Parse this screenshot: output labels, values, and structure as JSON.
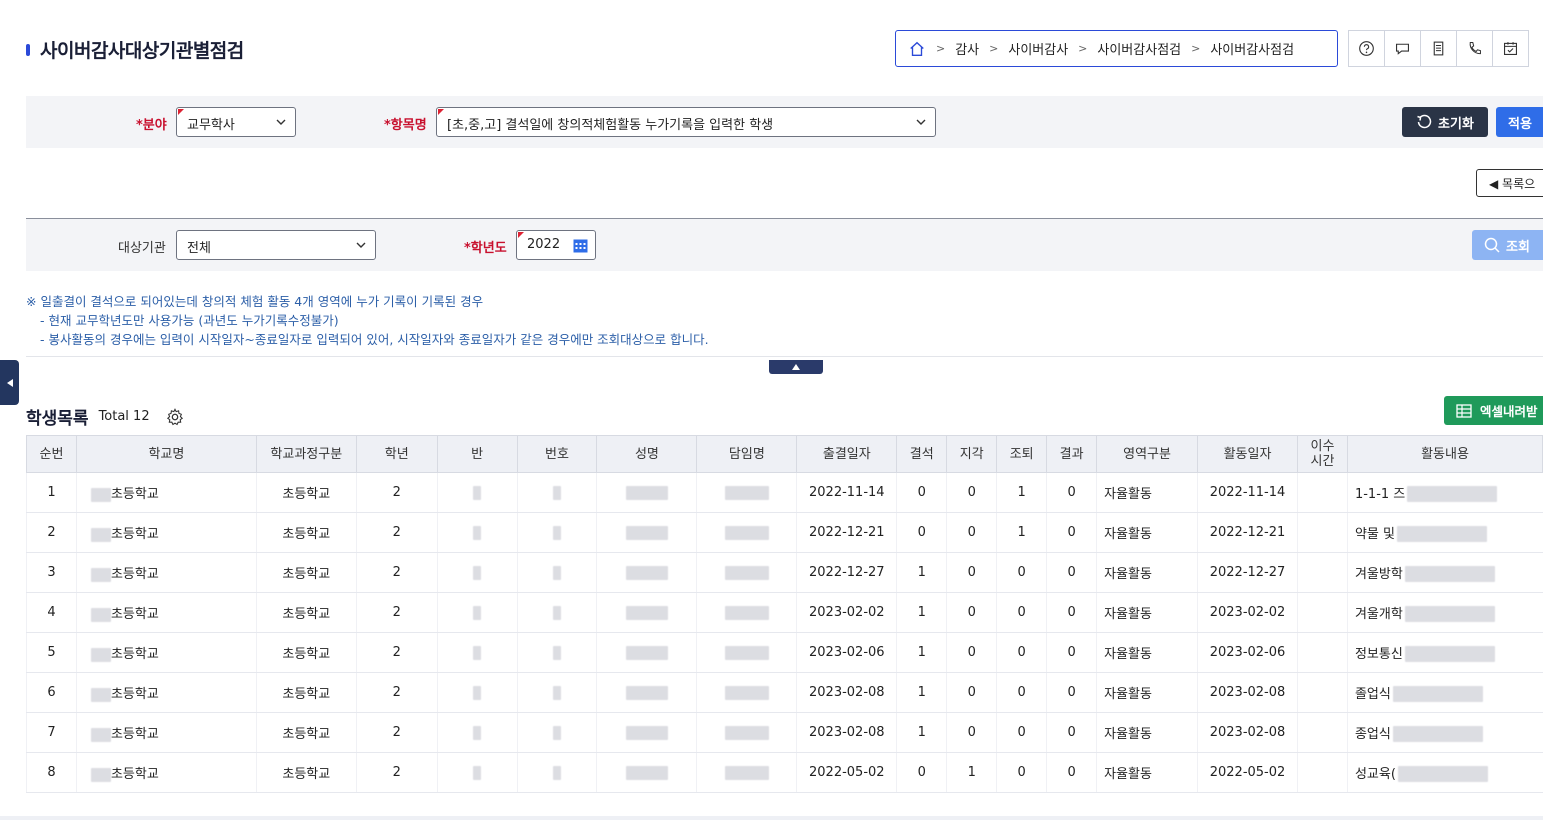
{
  "page": {
    "title": "사이버감사대상기관별점검"
  },
  "breadcrumb": {
    "items": [
      "감사",
      "사이버감사",
      "사이버감사점검",
      "사이버감사점검"
    ]
  },
  "filters": {
    "field_label": "*분야",
    "field_value": "교무학사",
    "item_label": "*항목명",
    "item_value": "[초,중,고] 결석일에 창의적체험활동 누가기록을 입력한 학생",
    "reset_label": "초기화",
    "apply_label": "적용",
    "list_label": "◀ 목록으",
    "target_label": "대상기관",
    "target_value": "전체",
    "year_label": "*학년도",
    "year_value": "2022",
    "search_label": "조회"
  },
  "notice": {
    "line1": "※ 일출결이 결석으로 되어있는데 창의적 체험 활동 4개 영역에 누가 기록이 기록된 경우",
    "line2": "- 현재 교무학년도만 사용가능 (과년도 누가기록수정불가)",
    "line3": "- 봉사활동의 경우에는 입력이 시작일자~종료일자로 입력되어 있어, 시작일자와 종료일자가 같은 경우에만 조회대상으로 합니다."
  },
  "list": {
    "title": "학생목록",
    "total": "Total 12",
    "excel_label": "엑셀내려받",
    "columns": [
      "순번",
      "학교명",
      "학교과정구분",
      "학년",
      "반",
      "번호",
      "성명",
      "담임명",
      "출결일자",
      "결석",
      "지각",
      "조퇴",
      "결과",
      "영역구분",
      "활동일자",
      "이수시간",
      "활동내용"
    ],
    "rows": [
      {
        "no": "1",
        "school": "초등학교",
        "course": "초등학교",
        "grade": "2",
        "date": "2022-11-14",
        "absent": "0",
        "late": "0",
        "early": "1",
        "result": "0",
        "area": "자율활동",
        "act_date": "2022-11-14",
        "hours": "",
        "content": "1-1-1 즈"
      },
      {
        "no": "2",
        "school": "초등학교",
        "course": "초등학교",
        "grade": "2",
        "date": "2022-12-21",
        "absent": "0",
        "late": "0",
        "early": "1",
        "result": "0",
        "area": "자율활동",
        "act_date": "2022-12-21",
        "hours": "",
        "content": "약물 및"
      },
      {
        "no": "3",
        "school": "초등학교",
        "course": "초등학교",
        "grade": "2",
        "date": "2022-12-27",
        "absent": "1",
        "late": "0",
        "early": "0",
        "result": "0",
        "area": "자율활동",
        "act_date": "2022-12-27",
        "hours": "",
        "content": "겨울방학"
      },
      {
        "no": "4",
        "school": "초등학교",
        "course": "초등학교",
        "grade": "2",
        "date": "2023-02-02",
        "absent": "1",
        "late": "0",
        "early": "0",
        "result": "0",
        "area": "자율활동",
        "act_date": "2023-02-02",
        "hours": "",
        "content": "겨울개학"
      },
      {
        "no": "5",
        "school": "초등학교",
        "course": "초등학교",
        "grade": "2",
        "date": "2023-02-06",
        "absent": "1",
        "late": "0",
        "early": "0",
        "result": "0",
        "area": "자율활동",
        "act_date": "2023-02-06",
        "hours": "",
        "content": "정보통신"
      },
      {
        "no": "6",
        "school": "초등학교",
        "course": "초등학교",
        "grade": "2",
        "date": "2023-02-08",
        "absent": "1",
        "late": "0",
        "early": "0",
        "result": "0",
        "area": "자율활동",
        "act_date": "2023-02-08",
        "hours": "",
        "content": "졸업식"
      },
      {
        "no": "7",
        "school": "초등학교",
        "course": "초등학교",
        "grade": "2",
        "date": "2023-02-08",
        "absent": "1",
        "late": "0",
        "early": "0",
        "result": "0",
        "area": "자율활동",
        "act_date": "2023-02-08",
        "hours": "",
        "content": "종업식"
      },
      {
        "no": "8",
        "school": "초등학교",
        "course": "초등학교",
        "grade": "2",
        "date": "2022-05-02",
        "absent": "0",
        "late": "1",
        "early": "0",
        "result": "0",
        "area": "자율활동",
        "act_date": "2022-05-02",
        "hours": "",
        "content": "성교육("
      }
    ]
  },
  "icons": [
    "home-icon",
    "help-icon",
    "chat-icon",
    "document-icon",
    "phone-icon",
    "calendar-check-icon",
    "chevron-down-icon",
    "refresh-icon",
    "search-icon",
    "calendar-icon",
    "gear-icon",
    "excel-icon"
  ],
  "colors": {
    "accent": "#2b4ad8",
    "required": "#c8102e",
    "excel": "#1f9a5a",
    "notice": "#2c5fa8"
  }
}
